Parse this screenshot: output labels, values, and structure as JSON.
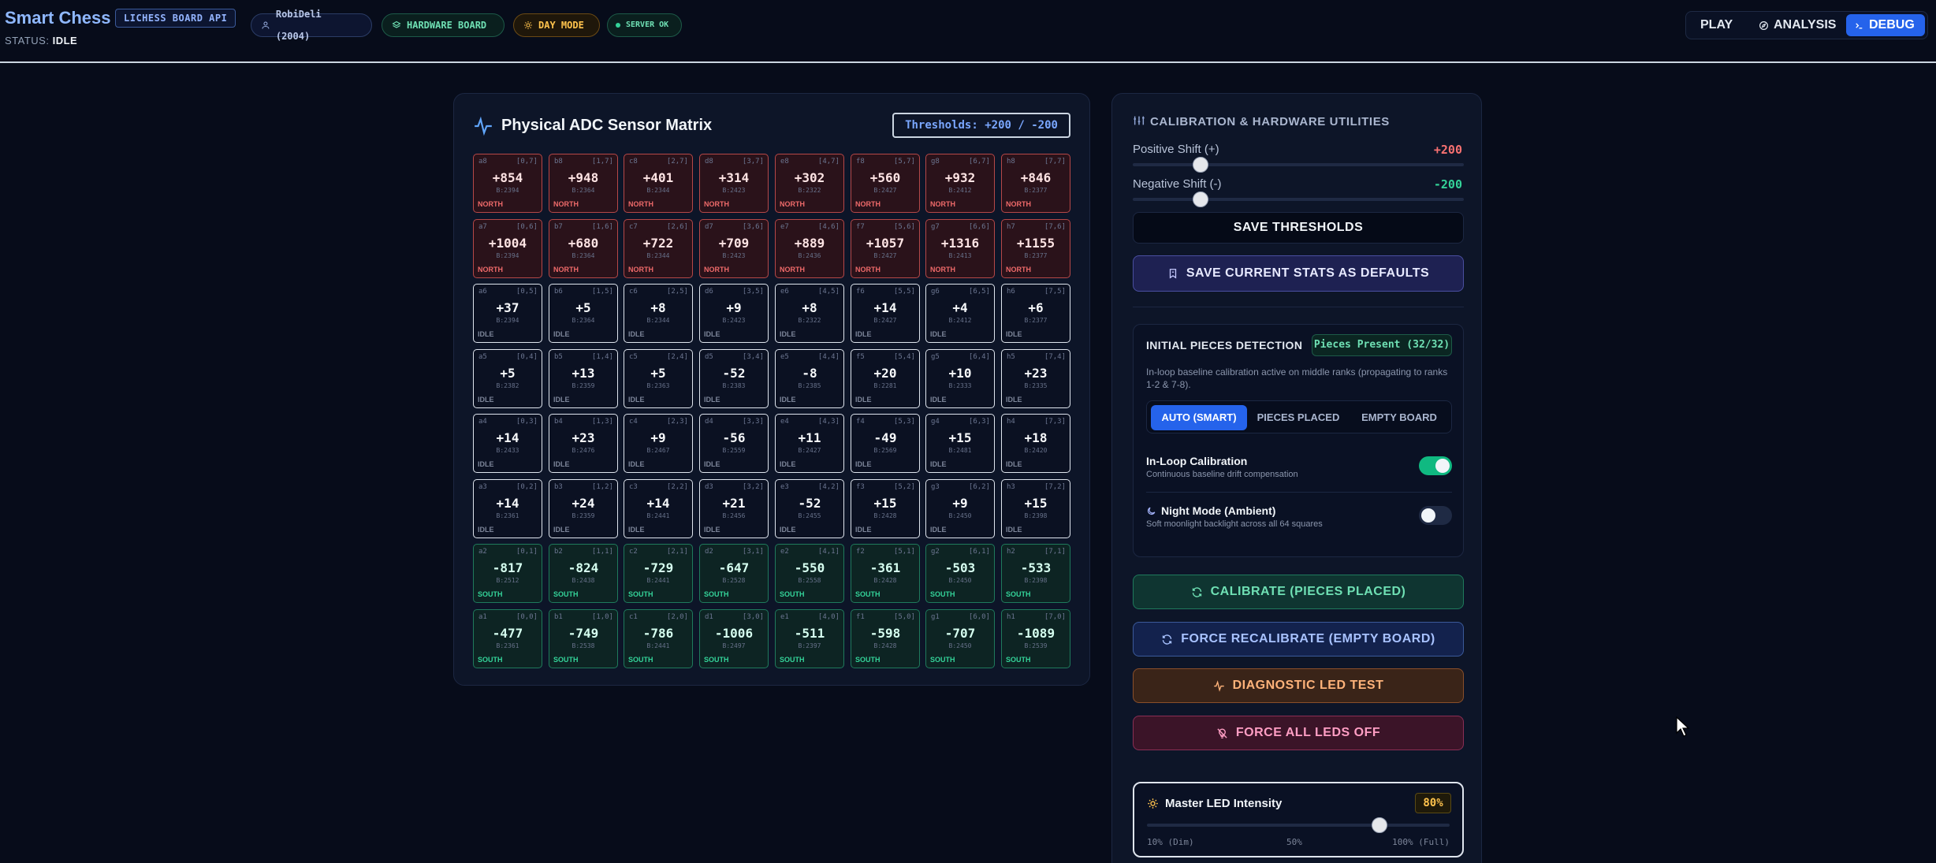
{
  "header": {
    "brand": "Smart Chess",
    "api_badge": "LICHESS BOARD API",
    "status_label": "STATUS:",
    "status_value": "IDLE",
    "user_pill": "RobiDeli (2004)",
    "hardware_pill": "HARDWARE BOARD",
    "mode_pill": "DAY MODE",
    "server_pill": "SERVER OK",
    "nav": {
      "play": "PLAY",
      "analysis": "ANALYSIS",
      "debug": "DEBUG"
    }
  },
  "sensor_panel": {
    "title": "Physical ADC Sensor Matrix",
    "thresholds_badge": "Thresholds: +200 / -200",
    "rows": [
      [
        {
          "sq": "a8",
          "co": "[0,7]",
          "val": "+854",
          "base": "B:2394",
          "state": "NORTH"
        },
        {
          "sq": "b8",
          "co": "[1,7]",
          "val": "+948",
          "base": "B:2364",
          "state": "NORTH"
        },
        {
          "sq": "c8",
          "co": "[2,7]",
          "val": "+401",
          "base": "B:2344",
          "state": "NORTH"
        },
        {
          "sq": "d8",
          "co": "[3,7]",
          "val": "+314",
          "base": "B:2423",
          "state": "NORTH"
        },
        {
          "sq": "e8",
          "co": "[4,7]",
          "val": "+302",
          "base": "B:2322",
          "state": "NORTH"
        },
        {
          "sq": "f8",
          "co": "[5,7]",
          "val": "+560",
          "base": "B:2427",
          "state": "NORTH"
        },
        {
          "sq": "g8",
          "co": "[6,7]",
          "val": "+932",
          "base": "B:2412",
          "state": "NORTH"
        },
        {
          "sq": "h8",
          "co": "[7,7]",
          "val": "+846",
          "base": "B:2377",
          "state": "NORTH"
        }
      ],
      [
        {
          "sq": "a7",
          "co": "[0,6]",
          "val": "+1004",
          "base": "B:2394",
          "state": "NORTH"
        },
        {
          "sq": "b7",
          "co": "[1,6]",
          "val": "+680",
          "base": "B:2364",
          "state": "NORTH"
        },
        {
          "sq": "c7",
          "co": "[2,6]",
          "val": "+722",
          "base": "B:2344",
          "state": "NORTH"
        },
        {
          "sq": "d7",
          "co": "[3,6]",
          "val": "+709",
          "base": "B:2423",
          "state": "NORTH"
        },
        {
          "sq": "e7",
          "co": "[4,6]",
          "val": "+889",
          "base": "B:2436",
          "state": "NORTH"
        },
        {
          "sq": "f7",
          "co": "[5,6]",
          "val": "+1057",
          "base": "B:2427",
          "state": "NORTH"
        },
        {
          "sq": "g7",
          "co": "[6,6]",
          "val": "+1316",
          "base": "B:2413",
          "state": "NORTH"
        },
        {
          "sq": "h7",
          "co": "[7,6]",
          "val": "+1155",
          "base": "B:2377",
          "state": "NORTH"
        }
      ],
      [
        {
          "sq": "a6",
          "co": "[0,5]",
          "val": "+37",
          "base": "B:2394",
          "state": "IDLE"
        },
        {
          "sq": "b6",
          "co": "[1,5]",
          "val": "+5",
          "base": "B:2364",
          "state": "IDLE"
        },
        {
          "sq": "c6",
          "co": "[2,5]",
          "val": "+8",
          "base": "B:2344",
          "state": "IDLE"
        },
        {
          "sq": "d6",
          "co": "[3,5]",
          "val": "+9",
          "base": "B:2423",
          "state": "IDLE"
        },
        {
          "sq": "e6",
          "co": "[4,5]",
          "val": "+8",
          "base": "B:2322",
          "state": "IDLE"
        },
        {
          "sq": "f6",
          "co": "[5,5]",
          "val": "+14",
          "base": "B:2427",
          "state": "IDLE"
        },
        {
          "sq": "g6",
          "co": "[6,5]",
          "val": "+4",
          "base": "B:2412",
          "state": "IDLE"
        },
        {
          "sq": "h6",
          "co": "[7,5]",
          "val": "+6",
          "base": "B:2377",
          "state": "IDLE"
        }
      ],
      [
        {
          "sq": "a5",
          "co": "[0,4]",
          "val": "+5",
          "base": "B:2382",
          "state": "IDLE"
        },
        {
          "sq": "b5",
          "co": "[1,4]",
          "val": "+13",
          "base": "B:2359",
          "state": "IDLE"
        },
        {
          "sq": "c5",
          "co": "[2,4]",
          "val": "+5",
          "base": "B:2363",
          "state": "IDLE"
        },
        {
          "sq": "d5",
          "co": "[3,4]",
          "val": "-52",
          "base": "B:2383",
          "state": "IDLE"
        },
        {
          "sq": "e5",
          "co": "[4,4]",
          "val": "-8",
          "base": "B:2385",
          "state": "IDLE"
        },
        {
          "sq": "f5",
          "co": "[5,4]",
          "val": "+20",
          "base": "B:2281",
          "state": "IDLE"
        },
        {
          "sq": "g5",
          "co": "[6,4]",
          "val": "+10",
          "base": "B:2333",
          "state": "IDLE"
        },
        {
          "sq": "h5",
          "co": "[7,4]",
          "val": "+23",
          "base": "B:2335",
          "state": "IDLE"
        }
      ],
      [
        {
          "sq": "a4",
          "co": "[0,3]",
          "val": "+14",
          "base": "B:2433",
          "state": "IDLE"
        },
        {
          "sq": "b4",
          "co": "[1,3]",
          "val": "+23",
          "base": "B:2476",
          "state": "IDLE"
        },
        {
          "sq": "c4",
          "co": "[2,3]",
          "val": "+9",
          "base": "B:2467",
          "state": "IDLE"
        },
        {
          "sq": "d4",
          "co": "[3,3]",
          "val": "-56",
          "base": "B:2559",
          "state": "IDLE"
        },
        {
          "sq": "e4",
          "co": "[4,3]",
          "val": "+11",
          "base": "B:2427",
          "state": "IDLE"
        },
        {
          "sq": "f4",
          "co": "[5,3]",
          "val": "-49",
          "base": "B:2569",
          "state": "IDLE"
        },
        {
          "sq": "g4",
          "co": "[6,3]",
          "val": "+15",
          "base": "B:2481",
          "state": "IDLE"
        },
        {
          "sq": "h4",
          "co": "[7,3]",
          "val": "+18",
          "base": "B:2420",
          "state": "IDLE"
        }
      ],
      [
        {
          "sq": "a3",
          "co": "[0,2]",
          "val": "+14",
          "base": "B:2361",
          "state": "IDLE"
        },
        {
          "sq": "b3",
          "co": "[1,2]",
          "val": "+24",
          "base": "B:2359",
          "state": "IDLE"
        },
        {
          "sq": "c3",
          "co": "[2,2]",
          "val": "+14",
          "base": "B:2441",
          "state": "IDLE"
        },
        {
          "sq": "d3",
          "co": "[3,2]",
          "val": "+21",
          "base": "B:2456",
          "state": "IDLE"
        },
        {
          "sq": "e3",
          "co": "[4,2]",
          "val": "-52",
          "base": "B:2455",
          "state": "IDLE"
        },
        {
          "sq": "f3",
          "co": "[5,2]",
          "val": "+15",
          "base": "B:2428",
          "state": "IDLE"
        },
        {
          "sq": "g3",
          "co": "[6,2]",
          "val": "+9",
          "base": "B:2450",
          "state": "IDLE"
        },
        {
          "sq": "h3",
          "co": "[7,2]",
          "val": "+15",
          "base": "B:2398",
          "state": "IDLE"
        }
      ],
      [
        {
          "sq": "a2",
          "co": "[0,1]",
          "val": "-817",
          "base": "B:2512",
          "state": "SOUTH"
        },
        {
          "sq": "b2",
          "co": "[1,1]",
          "val": "-824",
          "base": "B:2438",
          "state": "SOUTH"
        },
        {
          "sq": "c2",
          "co": "[2,1]",
          "val": "-729",
          "base": "B:2441",
          "state": "SOUTH"
        },
        {
          "sq": "d2",
          "co": "[3,1]",
          "val": "-647",
          "base": "B:2528",
          "state": "SOUTH"
        },
        {
          "sq": "e2",
          "co": "[4,1]",
          "val": "-550",
          "base": "B:2558",
          "state": "SOUTH"
        },
        {
          "sq": "f2",
          "co": "[5,1]",
          "val": "-361",
          "base": "B:2428",
          "state": "SOUTH"
        },
        {
          "sq": "g2",
          "co": "[6,1]",
          "val": "-503",
          "base": "B:2450",
          "state": "SOUTH"
        },
        {
          "sq": "h2",
          "co": "[7,1]",
          "val": "-533",
          "base": "B:2398",
          "state": "SOUTH"
        }
      ],
      [
        {
          "sq": "a1",
          "co": "[0,0]",
          "val": "-477",
          "base": "B:2361",
          "state": "SOUTH"
        },
        {
          "sq": "b1",
          "co": "[1,0]",
          "val": "-749",
          "base": "B:2538",
          "state": "SOUTH"
        },
        {
          "sq": "c1",
          "co": "[2,0]",
          "val": "-786",
          "base": "B:2441",
          "state": "SOUTH"
        },
        {
          "sq": "d1",
          "co": "[3,0]",
          "val": "-1006",
          "base": "B:2497",
          "state": "SOUTH"
        },
        {
          "sq": "e1",
          "co": "[4,0]",
          "val": "-511",
          "base": "B:2397",
          "state": "SOUTH"
        },
        {
          "sq": "f1",
          "co": "[5,0]",
          "val": "-598",
          "base": "B:2428",
          "state": "SOUTH"
        },
        {
          "sq": "g1",
          "co": "[6,0]",
          "val": "-707",
          "base": "B:2450",
          "state": "SOUTH"
        },
        {
          "sq": "h1",
          "co": "[7,0]",
          "val": "-1089",
          "base": "B:2539",
          "state": "SOUTH"
        }
      ]
    ]
  },
  "calibration": {
    "title": "CALIBRATION & HARDWARE UTILITIES",
    "positive_label": "Positive Shift (+)",
    "positive_value": "+200",
    "negative_label": "Negative Shift (-)",
    "negative_value": "-200",
    "save_thresholds": "SAVE THRESHOLDS",
    "save_defaults": "SAVE CURRENT STATS AS DEFAULTS",
    "initial_pieces": {
      "title": "INITIAL PIECES DETECTION",
      "badge": "Pieces Present (32/32)",
      "description": "In-loop baseline calibration active on middle ranks (propagating to ranks 1-2 & 7-8).",
      "modes": {
        "auto": "AUTO (SMART)",
        "placed": "PIECES PLACED",
        "empty": "EMPTY BOARD"
      },
      "inloop_title": "In-Loop Calibration",
      "inloop_sub": "Continuous baseline drift compensation",
      "inloop_on": true,
      "night_title": "Night Mode (Ambient)",
      "night_sub": "Soft moonlight backlight across all 64 squares",
      "night_on": false
    },
    "calibrate_placed": "CALIBRATE (PIECES PLACED)",
    "force_recalibrate": "FORCE RECALIBRATE (EMPTY BOARD)",
    "diagnostic": "DIAGNOSTIC LED TEST",
    "leds_off": "FORCE ALL LEDS OFF",
    "led": {
      "title": "Master LED Intensity",
      "value": "80%",
      "tick_min": "10% (Dim)",
      "tick_mid": "50%",
      "tick_max": "100% (Full)"
    }
  },
  "colors": {
    "accent": "#2563eb",
    "north": "#ef6a6a",
    "south": "#34d399",
    "positive": "#f87171",
    "negative": "#34d399"
  }
}
